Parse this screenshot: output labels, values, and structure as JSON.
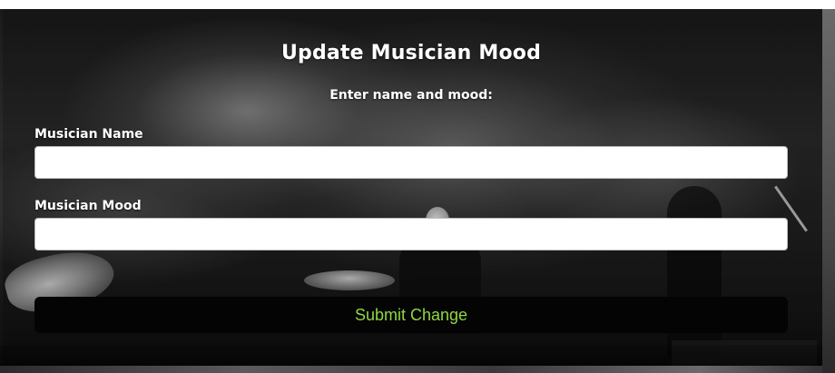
{
  "form": {
    "title": "Update Musician Mood",
    "subtitle": "Enter name and mood:",
    "fields": {
      "name": {
        "label": "Musician Name",
        "value": "",
        "placeholder": ""
      },
      "mood": {
        "label": "Musician Mood",
        "value": "",
        "placeholder": ""
      }
    },
    "submit_label": "Submit Change"
  },
  "colors": {
    "submit_text": "#8fd645",
    "submit_background": "#040404",
    "label_text": "#ffffff"
  },
  "background": {
    "image_description_icon": "concert-stage-photo"
  }
}
